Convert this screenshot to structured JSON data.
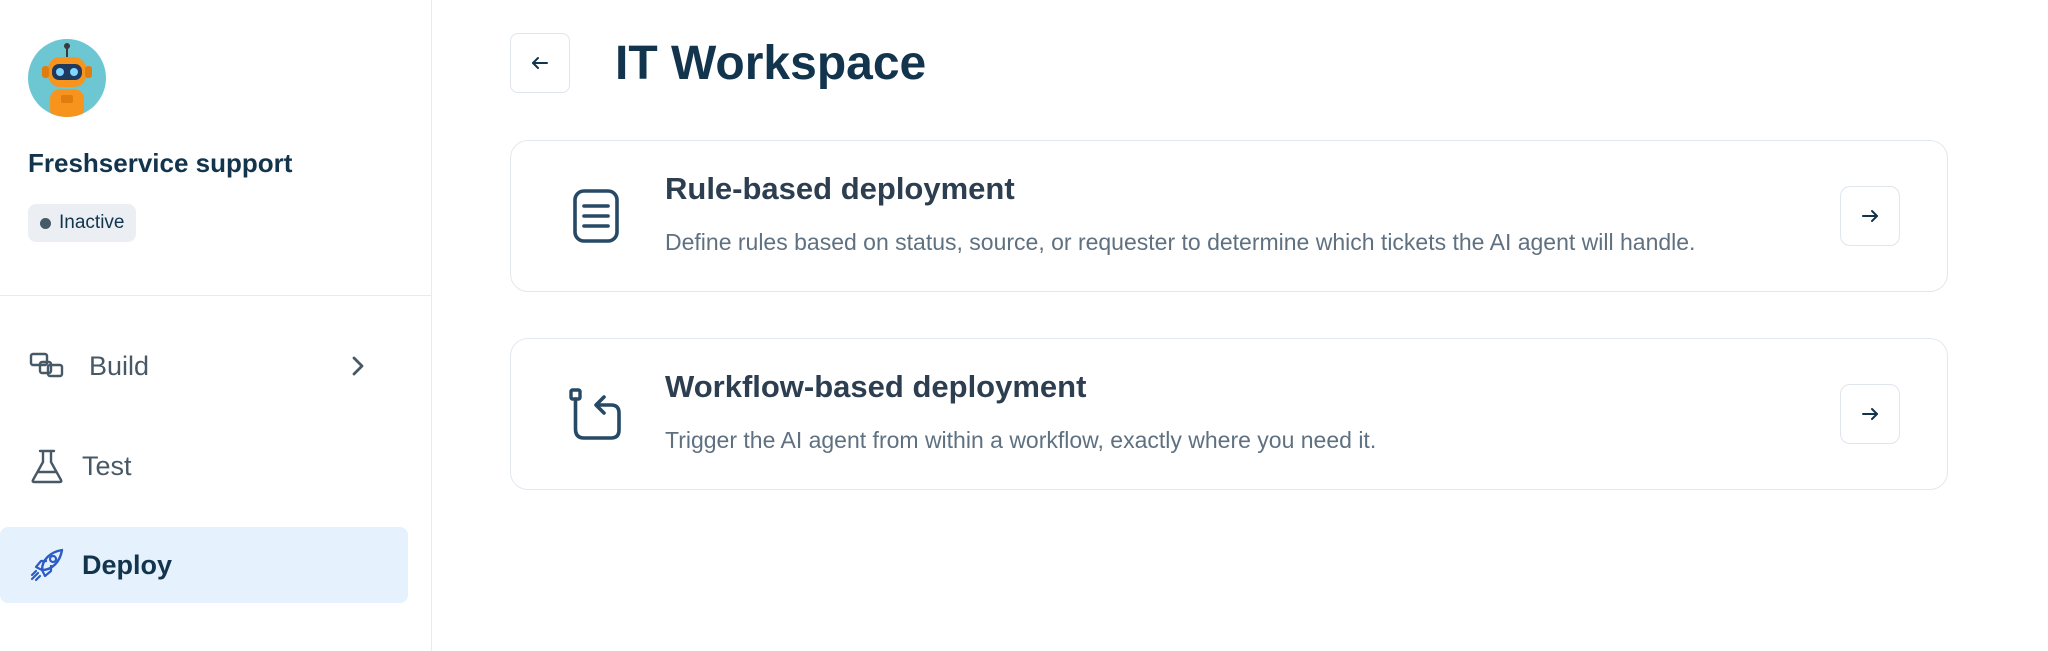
{
  "sidebar": {
    "agent_name": "Freshservice support",
    "status": "Inactive",
    "nav": [
      {
        "label": "Build",
        "icon": "build-icon"
      },
      {
        "label": "Test",
        "icon": "flask-icon"
      },
      {
        "label": "Deploy",
        "icon": "rocket-icon"
      }
    ]
  },
  "main": {
    "title": "IT Workspace",
    "cards": [
      {
        "title": "Rule-based deployment",
        "description": "Define rules based on status, source, or requester to determine which tickets the AI agent will handle.",
        "icon": "document-list-icon"
      },
      {
        "title": "Workflow-based deployment",
        "description": "Trigger the AI agent from within a workflow, exactly where you need it.",
        "icon": "workflow-return-icon"
      }
    ]
  },
  "colors": {
    "primary_text": "#12344d",
    "secondary_text": "#475867",
    "active_nav_bg": "#e5f2fd",
    "accent_blue": "#2c5cc5",
    "avatar_bg": "#6cc7d3",
    "robot_orange": "#f7941d"
  }
}
